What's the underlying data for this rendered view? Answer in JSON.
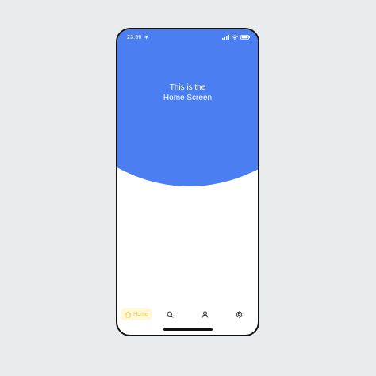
{
  "status_bar": {
    "time": "23:56",
    "icons": [
      "location-arrow-icon",
      "signal-icon",
      "wifi-icon",
      "battery-icon"
    ]
  },
  "hero": {
    "line1": "This is the",
    "line2": "Home Screen",
    "color": "#4b7ef0"
  },
  "tab_bar": {
    "home_label": "Home",
    "active_color": "#f2c94c",
    "active_background": "#fff8d9",
    "icons": [
      "home-icon",
      "search-icon",
      "profile-icon",
      "gear-icon"
    ]
  }
}
